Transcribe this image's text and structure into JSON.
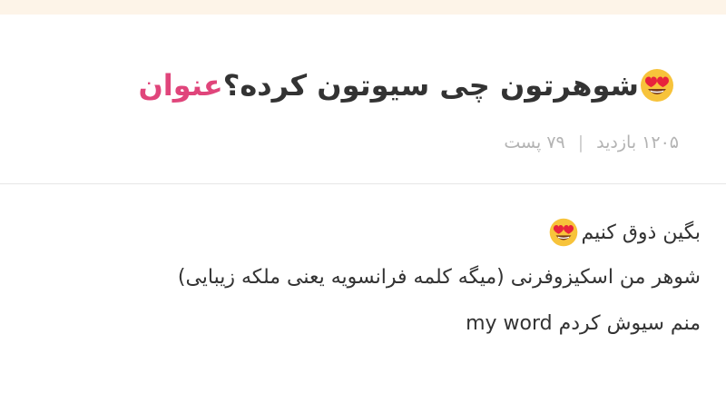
{
  "header": {
    "label": "عنوان",
    "title": "شوهرتون چی سیوتون کرده؟",
    "title_emoji": "heart-eyes-emoji",
    "views": "۱۲۰۵ بازدید",
    "separator": "|",
    "posts": "۷۹ پست"
  },
  "post": {
    "line1": "بگین ذوق کنیم",
    "line1_emoji": "heart-eyes-emoji",
    "line2": "شوهر من اسکیزوفرنی (میگه کلمه فرانسویه یعنی ملکه زیبایی)",
    "line3": "منم سیوش کردم my word"
  },
  "colors": {
    "accent": "#e0457b",
    "top_strip": "#fdf4e8",
    "meta_text": "#b3b3b3"
  }
}
